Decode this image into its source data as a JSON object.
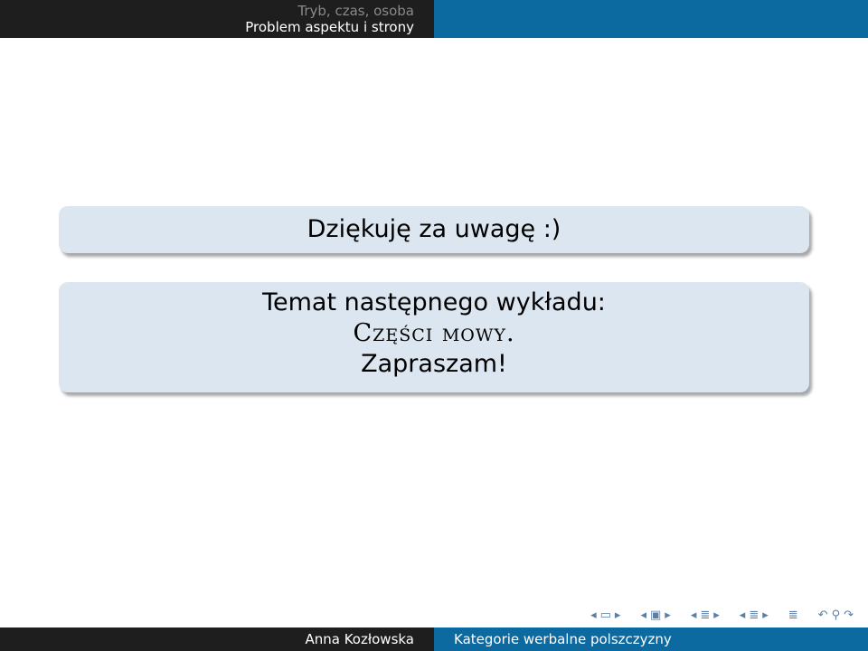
{
  "header": {
    "section": "Tryb, czas, osoba",
    "subsection": "Problem aspektu i strony"
  },
  "blocks": {
    "thanks": "Dziękuję za uwagę :)",
    "next_topic_label": "Temat następnego wykładu:",
    "next_topic_title": "Części mowy.",
    "invite": "Zapraszam!"
  },
  "nav": {
    "icons": [
      "nav-prev-slide",
      "nav-frame",
      "nav-next-slide",
      "nav-prev-subsection",
      "nav-subsection",
      "nav-next-subsection",
      "nav-prev-section",
      "nav-section",
      "nav-next-section",
      "nav-document",
      "nav-back",
      "nav-search",
      "nav-forward"
    ],
    "color": "#5c7fa6"
  },
  "footer": {
    "author": "Anna Kozłowska",
    "title": "Kategorie werbalne polszczyzny"
  },
  "colors": {
    "header_dark": "#1e1e1e",
    "header_blue": "#0d6aa0",
    "block_bg": "#dce6f0"
  }
}
